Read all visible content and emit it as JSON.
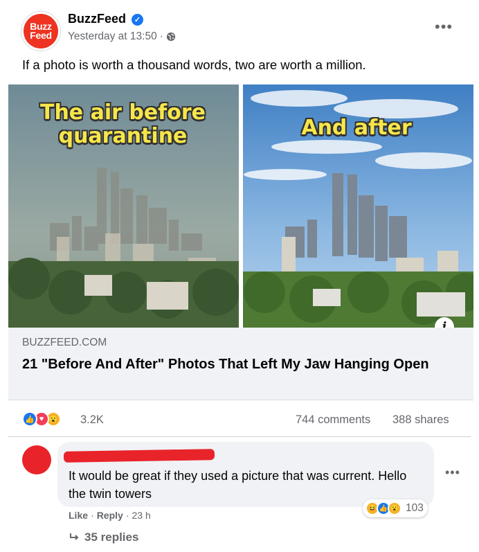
{
  "post": {
    "page_name": "BuzzFeed",
    "avatar_text_1": "Buzz",
    "avatar_text_2": "Feed",
    "verified_icon": "verified-badge-icon",
    "timestamp": "Yesterday at 13:50",
    "meta_sep": "·",
    "privacy_icon": "globe-icon",
    "more_icon": "•••",
    "text": "If a photo is worth a thousand words, two are worth a million."
  },
  "image": {
    "caption_left_line1": "The air before",
    "caption_left_line2": "quarantine",
    "caption_right": "And after",
    "info_icon": "i"
  },
  "link": {
    "domain": "BUZZFEED.COM",
    "title": "21 \"Before And After\" Photos That Left My Jaw Hanging Open"
  },
  "stats": {
    "reactions": [
      "like",
      "love",
      "wow"
    ],
    "reaction_count": "3.2K",
    "comments": "744 comments",
    "shares": "388 shares"
  },
  "comment": {
    "text": "It would be great if they used a picture that was current. Hello the twin towers",
    "more_icon": "•••",
    "reaction_count": "103",
    "like": "Like",
    "sep": "·",
    "reply": "Reply",
    "age": "23 h",
    "replies": "35 replies"
  },
  "colors": {
    "brand_red": "#ee3322",
    "facebook_blue": "#1877f2",
    "secondary_text": "#65676b",
    "caption_yellow": "#f7e64a"
  }
}
